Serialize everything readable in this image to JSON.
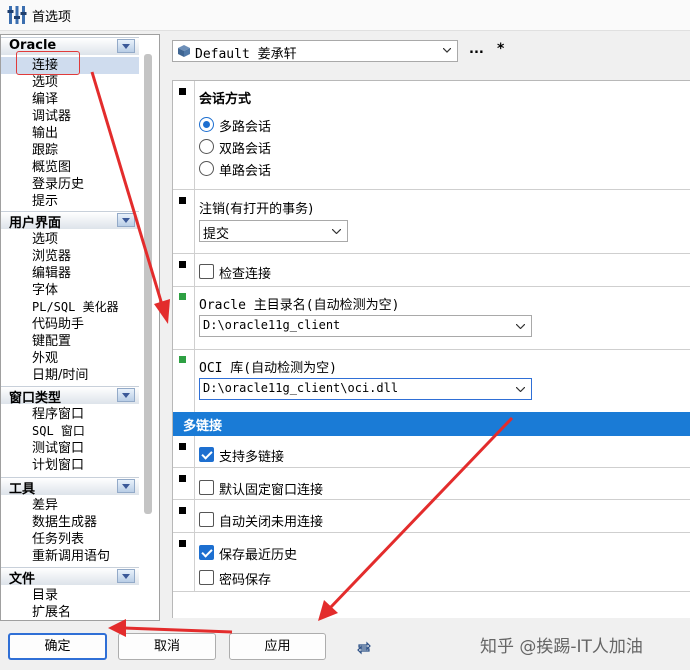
{
  "window": {
    "title": "首选项"
  },
  "sidebar": {
    "categories": [
      {
        "label": "Oracle",
        "items": [
          "连接",
          "选项",
          "编译",
          "调试器",
          "输出",
          "跟踪",
          "概览图",
          "登录历史",
          "提示"
        ]
      },
      {
        "label": "用户界面",
        "items": [
          "选项",
          "浏览器",
          "编辑器",
          "字体",
          "PL/SQL 美化器",
          "代码助手",
          "键配置",
          "外观",
          "日期/时间"
        ]
      },
      {
        "label": "窗口类型",
        "items": [
          "程序窗口",
          "SQL 窗口",
          "测试窗口",
          "计划窗口"
        ]
      },
      {
        "label": "工具",
        "items": [
          "差异",
          "数据生成器",
          "任务列表",
          "重新调用语句"
        ]
      },
      {
        "label": "文件",
        "items": [
          "目录",
          "扩展名"
        ]
      }
    ]
  },
  "profile": {
    "value": "Default 姜承轩",
    "more_label": "...",
    "star_label": "*"
  },
  "settings": {
    "session_mode": {
      "title": "会话方式",
      "options": [
        "多路会话",
        "双路会话",
        "单路会话"
      ],
      "selected": 0
    },
    "logoff": {
      "title": "注销(有打开的事务)",
      "value": "提交"
    },
    "check_connection": {
      "label": "检查连接",
      "checked": false
    },
    "oracle_home": {
      "title": "Oracle 主目录名(自动检测为空)",
      "value": "D:\\oracle11g_client"
    },
    "oci_library": {
      "title": "OCI 库(自动检测为空)",
      "value": "D:\\oracle11g_client\\oci.dll"
    },
    "multi_connection": {
      "header": "多链接",
      "support": {
        "label": "支持多链接",
        "checked": true
      },
      "fixed_window": {
        "label": "默认固定窗口连接",
        "checked": false
      },
      "auto_close": {
        "label": "自动关闭未用连接",
        "checked": false
      },
      "save_history": {
        "label": "保存最近历史",
        "checked": true
      },
      "save_password": {
        "label": "密码保存",
        "checked": false
      }
    }
  },
  "footer": {
    "ok_label": "确定",
    "cancel_label": "取消",
    "apply_label": "应用"
  },
  "watermark": "知乎 @挨踢-IT人加油",
  "colors": {
    "accent": "#1a7bd6",
    "annotation": "#e32c2c",
    "selection": "#cfdcee"
  }
}
